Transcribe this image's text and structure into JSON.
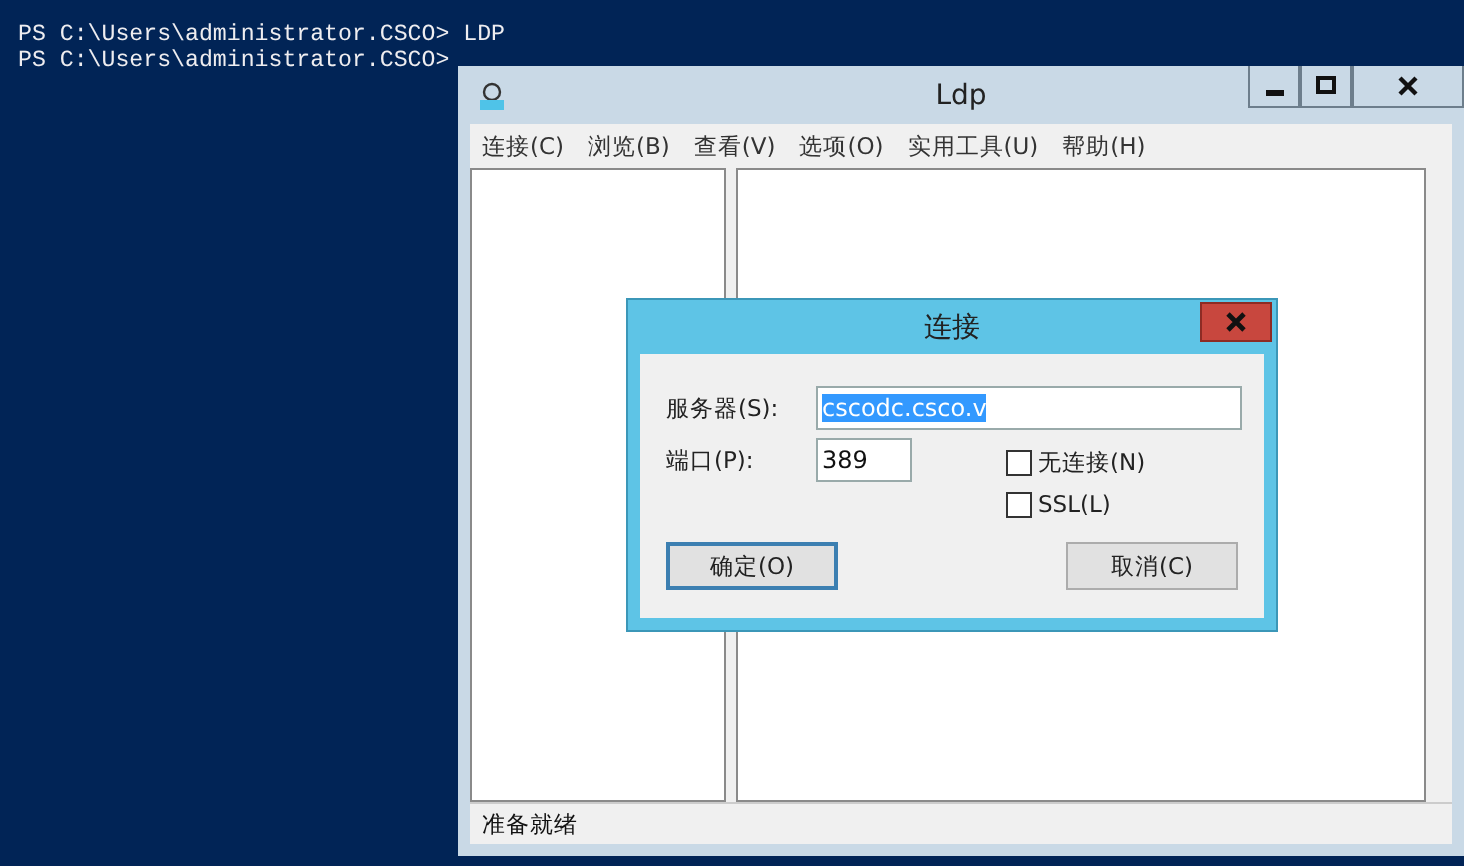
{
  "console": {
    "lines": [
      "PS C:\\Users\\administrator.CSCO> LDP",
      "PS C:\\Users\\administrator.CSCO>"
    ]
  },
  "window": {
    "title": "Ldp",
    "menu": [
      "连接(C)",
      "浏览(B)",
      "查看(V)",
      "选项(O)",
      "实用工具(U)",
      "帮助(H)"
    ],
    "status_bar": "准备就绪"
  },
  "dialog": {
    "title": "连接",
    "fields": [
      {
        "label": "服务器(S):",
        "value": "cscodc.csco.v",
        "selected": true
      },
      {
        "label": "端口(P):",
        "value": "389",
        "selected": false
      }
    ],
    "checkboxes": [
      {
        "label": "无连接(N)",
        "checked": false
      },
      {
        "label": "SSL(L)",
        "checked": false
      }
    ],
    "buttons": [
      {
        "label": "确定(O)",
        "default": true
      },
      {
        "label": "取消(C)",
        "default": false
      }
    ]
  }
}
